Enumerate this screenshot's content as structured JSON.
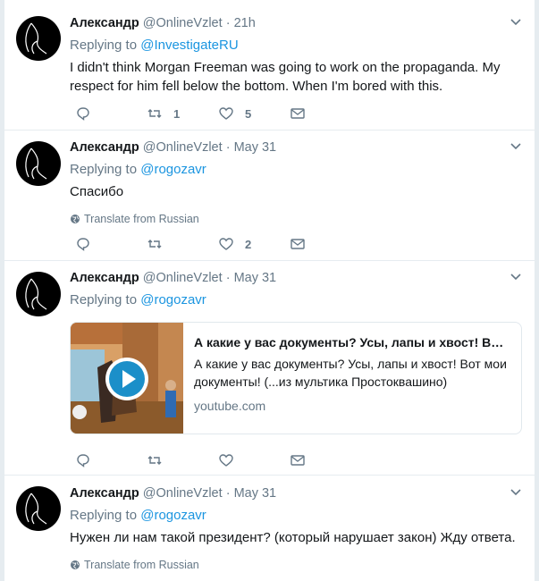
{
  "tweets": [
    {
      "name": "Александр",
      "handle": "@OnlineVzlet",
      "dot": "·",
      "time": "21h",
      "replying_prefix": "Replying to",
      "replying_to": "@InvestigateRU",
      "text": "I didn't think Morgan Freeman was going to work on the propaganda. My respect for him fell below the bottom. When I'm bored with this.",
      "retweets": "1",
      "likes": "5"
    },
    {
      "name": "Александр",
      "handle": "@OnlineVzlet",
      "dot": "·",
      "time": "May 31",
      "replying_prefix": "Replying to",
      "replying_to": "@rogozavr",
      "text": "Спасибо",
      "translate": "Translate from Russian",
      "retweets": "",
      "likes": "2"
    },
    {
      "name": "Александр",
      "handle": "@OnlineVzlet",
      "dot": "·",
      "time": "May 31",
      "replying_prefix": "Replying to",
      "replying_to": "@rogozavr",
      "card": {
        "title": "А какие у вас документы? Усы, лапы и хвост! Вот мои ...",
        "description": "А какие у вас документы? Усы, лапы и хвост! Вот мои документы! (...из мультика Простоквашино)",
        "domain": "youtube.com"
      },
      "retweets": "",
      "likes": ""
    },
    {
      "name": "Александр",
      "handle": "@OnlineVzlet",
      "dot": "·",
      "time": "May 31",
      "replying_prefix": "Replying to",
      "replying_to": "@rogozavr",
      "text": "Нужен ли нам такой президент? (который нарушает закон) Жду ответа.",
      "translate": "Translate from Russian"
    }
  ],
  "colors": {
    "link": "#1b95e0",
    "muted": "#657786",
    "text": "#14171a",
    "border": "#e6ecf0"
  },
  "icons": [
    "reply-icon",
    "retweet-icon",
    "like-icon",
    "direct-message-icon",
    "caret-down-icon",
    "globe-icon",
    "play-icon"
  ]
}
